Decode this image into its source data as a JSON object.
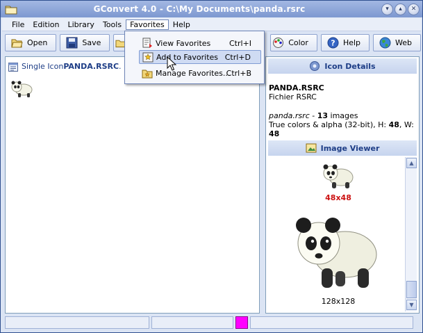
{
  "window": {
    "title": "GConvert 4.0 - C:\\My Documents\\panda.rsrc",
    "controls": [
      "minimize",
      "maximize",
      "close"
    ]
  },
  "menubar": {
    "items": [
      {
        "label": "File"
      },
      {
        "label": "Edition"
      },
      {
        "label": "Library"
      },
      {
        "label": "Tools"
      },
      {
        "label": "Favorites",
        "open": true
      },
      {
        "label": "Help"
      }
    ]
  },
  "toolbar": {
    "open_label": "Open",
    "save_label": "Save",
    "color_label": "Color",
    "help_label": "Help",
    "web_label": "Web"
  },
  "favorites_menu": {
    "items": [
      {
        "label": "View Favorites",
        "shortcut": "Ctrl+I",
        "icon": "view-favorites-icon"
      },
      {
        "label": "Add to Favorites",
        "shortcut": "Ctrl+D",
        "icon": "add-favorites-icon",
        "highlighted": true
      },
      {
        "label": "Manage Favorites...",
        "shortcut": "Ctrl+B",
        "icon": "manage-favorites-icon"
      }
    ]
  },
  "left_panel": {
    "header_prefix": "Single Icon ",
    "header_name": "PANDA.RSRC",
    "header_suffix": "."
  },
  "icon_details": {
    "heading": "Icon Details",
    "file_name": "PANDA.RSRC",
    "file_type": "Fichier RSRC",
    "source_name": "panda.rsrc",
    "separator": " - ",
    "image_count": "13",
    "image_count_suffix": " images",
    "color_desc": "True colors & alpha (32-bit), H: ",
    "height": "48",
    "width_sep": ", W: ",
    "width": "48"
  },
  "image_viewer": {
    "heading": "Image Viewer",
    "selected_size": "48x48",
    "large_size": "128x128"
  },
  "statusbar": {
    "color_swatch": "#ff00ff"
  },
  "colors": {
    "accent": "#1d3d86",
    "selected_size": "#cc1111"
  }
}
